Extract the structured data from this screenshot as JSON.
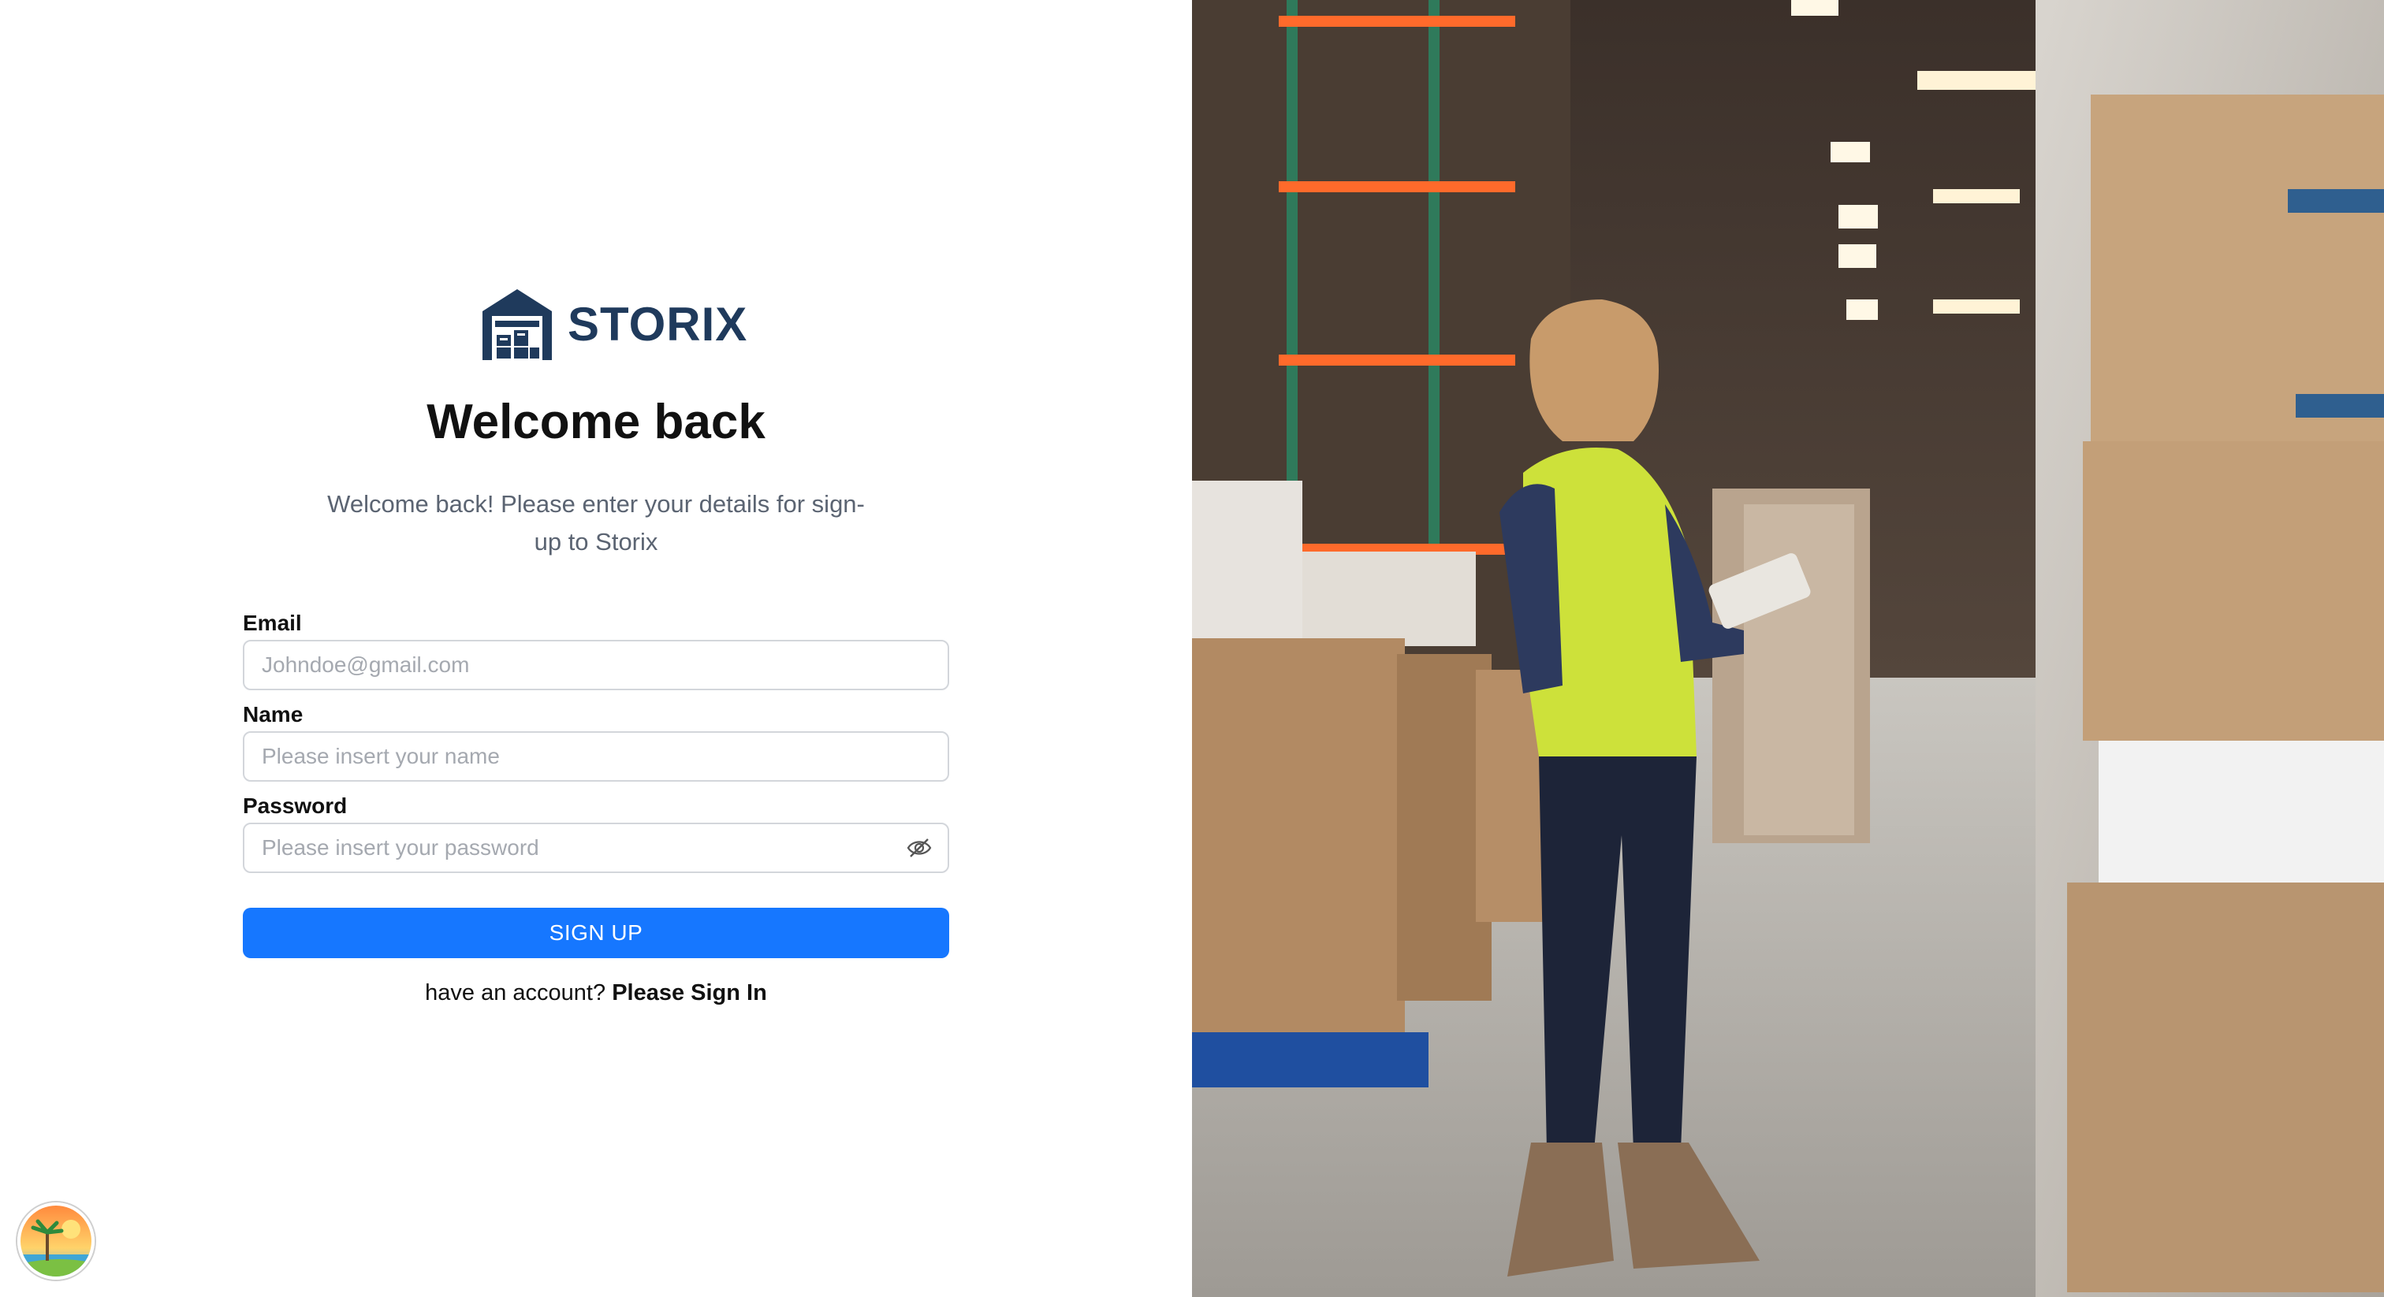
{
  "brand": {
    "name": "STORIX",
    "color": "#1f3a5c"
  },
  "heading": {
    "title": "Welcome back",
    "subtitle": "Welcome back! Please enter your details for sign-up to Storix"
  },
  "form": {
    "email": {
      "label": "Email",
      "placeholder": "Johndoe@gmail.com",
      "value": ""
    },
    "name": {
      "label": "Name",
      "placeholder": "Please insert your name",
      "value": ""
    },
    "password": {
      "label": "Password",
      "placeholder": "Please insert your password",
      "value": "",
      "toggle_icon": "eye-slash-icon"
    },
    "submit_label": "SIGN UP",
    "submit_color": "#1677ff"
  },
  "footer": {
    "prompt": "have an account?",
    "link_label": "Please Sign In"
  },
  "hero_image": {
    "icon": "warehouse-worker-photo"
  },
  "corner_badge": {
    "icon": "beach-avatar-icon"
  }
}
